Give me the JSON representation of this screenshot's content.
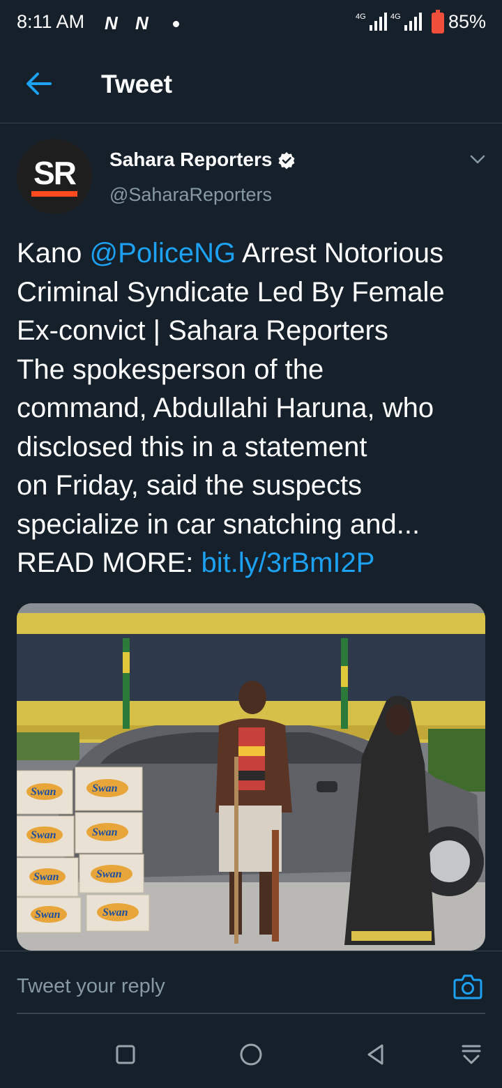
{
  "status_bar": {
    "time": "8:11 AM",
    "notification_icons": [
      "N",
      "N"
    ],
    "network_label_1": "4G",
    "network_label_2": "4G",
    "battery": "85%"
  },
  "header": {
    "title": "Tweet",
    "back_icon": "arrow-left-icon"
  },
  "tweet": {
    "author": {
      "avatar_text": "SR",
      "name": "Sahara Reporters",
      "handle": "@SaharaReporters",
      "verified": true
    },
    "text": {
      "l1_prefix": "Kano ",
      "mention": "@PoliceNG",
      "l1_suffix": " Arrest Notorious",
      "l2": "Criminal Syndicate Led By Female",
      "l3": "Ex-convict | Sahara Reporters",
      "l4": "The spokesperson of the",
      "l5": "command, Abdullahi Haruna, who",
      "l6": "disclosed this in a statement",
      "l7": "on Friday, said the suspects",
      "l8": "specialize in car snatching and...",
      "l9_prefix": "READ MORE: ",
      "link": "bit.ly/3rBmI2P"
    },
    "media": {
      "box_label": "Swan"
    }
  },
  "reply": {
    "placeholder": "Tweet your reply",
    "camera_icon": "camera-icon"
  },
  "colors": {
    "background": "#15202b",
    "accent": "#1da1f2",
    "secondary_text": "#8899a6",
    "divider": "#38444d"
  }
}
